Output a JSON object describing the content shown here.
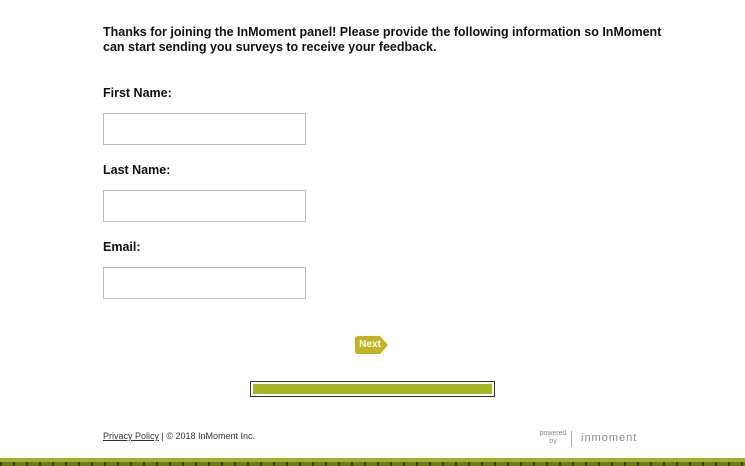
{
  "intro": {
    "text": "Thanks for joining the InMoment panel! Please provide the following information so InMoment can start sending you surveys to receive your feedback."
  },
  "form": {
    "first_name": {
      "label": "First Name:",
      "value": "",
      "placeholder": ""
    },
    "last_name": {
      "label": "Last Name:",
      "value": "",
      "placeholder": ""
    },
    "email": {
      "label": "Email:",
      "value": "",
      "placeholder": ""
    }
  },
  "actions": {
    "next_label": "Next"
  },
  "progress": {
    "percent": 100
  },
  "footer": {
    "privacy_link": "Privacy Policy",
    "copyright": " | © 2018 InMoment Inc.",
    "powered_by": "powered by",
    "brand": "inmoment"
  },
  "colors": {
    "accent": "#a4b623",
    "next_button": "#c2b323",
    "bottom_band": "#a3b22b"
  },
  "icons": {
    "next": "arrow-right-shape"
  }
}
